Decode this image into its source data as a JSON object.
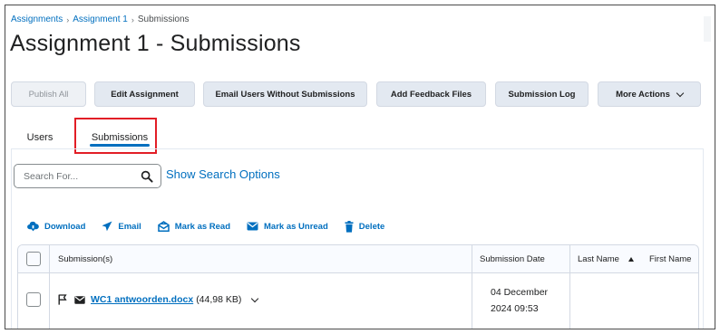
{
  "breadcrumb": {
    "items": [
      "Assignments",
      "Assignment 1",
      "Submissions"
    ],
    "separator": "›"
  },
  "page_title": "Assignment 1 - Submissions",
  "toolbar": {
    "publish_all": "Publish All",
    "edit_assignment": "Edit Assignment",
    "email_users": "Email Users Without Submissions",
    "add_feedback": "Add Feedback Files",
    "submission_log": "Submission Log",
    "more_actions": "More Actions"
  },
  "tabs": {
    "users": "Users",
    "submissions": "Submissions",
    "active": "Submissions"
  },
  "search": {
    "placeholder": "Search For...",
    "show_options": "Show Search Options"
  },
  "actions": {
    "download": "Download",
    "email": "Email",
    "mark_read": "Mark as Read",
    "mark_unread": "Mark as Unread",
    "delete": "Delete"
  },
  "table": {
    "headers": {
      "submissions": "Submission(s)",
      "date": "Submission Date",
      "last_name": "Last Name",
      "first_name": "First Name"
    },
    "rows": [
      {
        "file": "WC1 antwoorden.docx",
        "size": "(44,98 KB)",
        "date_line1": "04 December",
        "date_line2": "2024 09:53",
        "last_name": "",
        "first_name": ""
      }
    ]
  },
  "colors": {
    "link": "#006fbf",
    "button_bg": "#e3e9f1",
    "highlight": "#e21e26"
  },
  "icons": [
    "search-icon",
    "download-icon",
    "send-icon",
    "mark-read-icon",
    "mail-icon",
    "trash-icon",
    "flag-icon",
    "chevron-down-icon",
    "sort-ascending-icon"
  ]
}
